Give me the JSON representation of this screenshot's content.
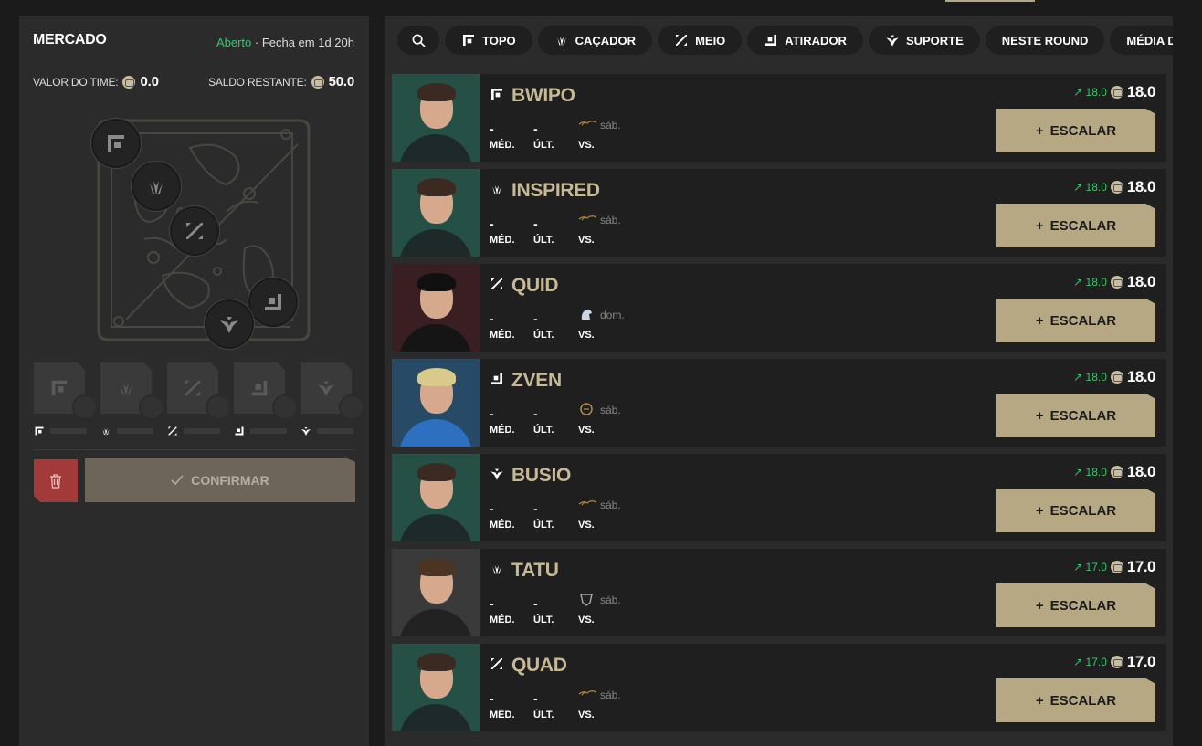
{
  "market": {
    "title": "MERCADO",
    "status_open": "Aberto",
    "status_rest": " · Fecha em 1d 20h",
    "team_value_label": "VALOR DO TIME:",
    "team_value": "0.0",
    "balance_label": "SALDO RESTANTE:",
    "balance": "50.0",
    "confirm_label": "CONFIRMAR",
    "slots": [
      {
        "role": "top-icon"
      },
      {
        "role": "jungle-icon"
      },
      {
        "role": "mid-icon"
      },
      {
        "role": "bot-icon"
      },
      {
        "role": "support-icon"
      }
    ]
  },
  "filters": {
    "items": [
      {
        "label": "TOPO",
        "icon": "top-icon"
      },
      {
        "label": "CAÇADOR",
        "icon": "jungle-icon"
      },
      {
        "label": "MEIO",
        "icon": "mid-icon"
      },
      {
        "label": "ATIRADOR",
        "icon": "bot-icon"
      },
      {
        "label": "SUPORTE",
        "icon": "support-icon"
      },
      {
        "label": "NESTE ROUND",
        "icon": ""
      },
      {
        "label": "MÉDIA DE PTS",
        "icon": ""
      }
    ]
  },
  "labels": {
    "avg": "MÉD.",
    "last": "ÚLT.",
    "vs": "VS.",
    "pick": "ESCALAR"
  },
  "players": [
    {
      "name": "BWIPO",
      "role": "top-icon",
      "avg": "-",
      "last": "-",
      "opp_day": "sáb.",
      "opp_icon": "gold-logo-icon",
      "delta": "18.0",
      "price": "18.0",
      "photo": "green"
    },
    {
      "name": "INSPIRED",
      "role": "jungle-icon",
      "avg": "-",
      "last": "-",
      "opp_day": "sáb.",
      "opp_icon": "gold-logo-icon",
      "delta": "18.0",
      "price": "18.0",
      "photo": "green"
    },
    {
      "name": "QUID",
      "role": "mid-icon",
      "avg": "-",
      "last": "-",
      "opp_day": "dom.",
      "opp_icon": "horse-logo-icon",
      "delta": "18.0",
      "price": "18.0",
      "photo": "red"
    },
    {
      "name": "ZVEN",
      "role": "bot-icon",
      "avg": "-",
      "last": "-",
      "opp_day": "sáb.",
      "opp_icon": "lion-logo-icon",
      "delta": "18.0",
      "price": "18.0",
      "photo": "blue"
    },
    {
      "name": "BUSIO",
      "role": "support-icon",
      "avg": "-",
      "last": "-",
      "opp_day": "sáb.",
      "opp_icon": "gold-logo-icon",
      "delta": "18.0",
      "price": "18.0",
      "photo": "green"
    },
    {
      "name": "TATU",
      "role": "jungle-icon",
      "avg": "-",
      "last": "-",
      "opp_day": "sáb.",
      "opp_icon": "shield-logo-icon",
      "delta": "17.0",
      "price": "17.0",
      "photo": "grey"
    },
    {
      "name": "QUAD",
      "role": "mid-icon",
      "avg": "-",
      "last": "-",
      "opp_day": "sáb.",
      "opp_icon": "gold-logo-icon",
      "delta": "17.0",
      "price": "17.0",
      "photo": "green"
    }
  ],
  "colors": {
    "accent": "#b5a882",
    "open": "#3cc46b",
    "name": "#c6b994",
    "danger": "#a23a3a"
  }
}
